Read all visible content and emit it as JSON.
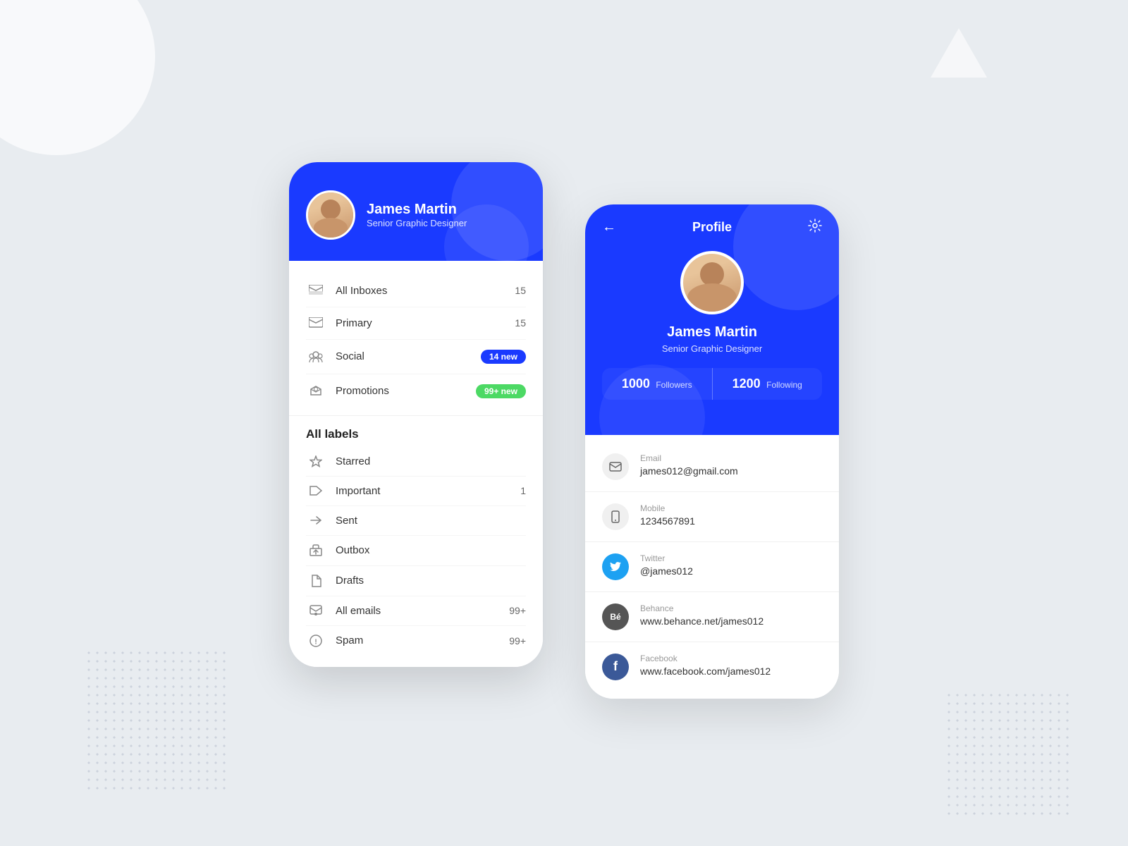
{
  "page": {
    "background": "#e8ecf0"
  },
  "phone1": {
    "header": {
      "user_name": "James Martin",
      "user_role": "Senior Graphic Designer"
    },
    "inbox": {
      "title": "All Inboxes",
      "all_inboxes_count": "15",
      "items": [
        {
          "icon": "inbox-icon",
          "label": "Primary",
          "count": "15",
          "badge": null
        },
        {
          "icon": "social-icon",
          "label": "Social",
          "count": null,
          "badge": "14 new",
          "badge_type": "blue"
        },
        {
          "icon": "promotions-icon",
          "label": "Promotions",
          "count": null,
          "badge": "99+ new",
          "badge_type": "green"
        }
      ]
    },
    "labels": {
      "title": "All labels",
      "items": [
        {
          "icon": "star-icon",
          "label": "Starred",
          "count": ""
        },
        {
          "icon": "important-icon",
          "label": "Important",
          "count": "1"
        },
        {
          "icon": "sent-icon",
          "label": "Sent",
          "count": ""
        },
        {
          "icon": "outbox-icon",
          "label": "Outbox",
          "count": ""
        },
        {
          "icon": "drafts-icon",
          "label": "Drafts",
          "count": ""
        },
        {
          "icon": "all-emails-icon",
          "label": "All emails",
          "count": "99+"
        },
        {
          "icon": "spam-icon",
          "label": "Spam",
          "count": "99+"
        }
      ]
    }
  },
  "phone2": {
    "nav": {
      "back_label": "←",
      "title": "Profile",
      "settings_label": "⚙"
    },
    "profile": {
      "name": "James Martin",
      "role": "Senior Graphic Designer",
      "followers_count": "1000",
      "followers_label": "Followers",
      "following_count": "1200",
      "following_label": "Following"
    },
    "contacts": [
      {
        "icon_type": "email",
        "icon_label": "✉",
        "label": "Email",
        "value": "james012@gmail.com"
      },
      {
        "icon_type": "phone",
        "icon_label": "📱",
        "label": "Mobile",
        "value": "1234567891"
      },
      {
        "icon_type": "twitter",
        "icon_label": "🐦",
        "label": "Twitter",
        "value": "@james012"
      },
      {
        "icon_type": "behance",
        "icon_label": "Bé",
        "label": "Behance",
        "value": "www.behance.net/james012"
      },
      {
        "icon_type": "facebook",
        "icon_label": "f",
        "label": "Facebook",
        "value": "www.facebook.com/james012"
      }
    ]
  }
}
